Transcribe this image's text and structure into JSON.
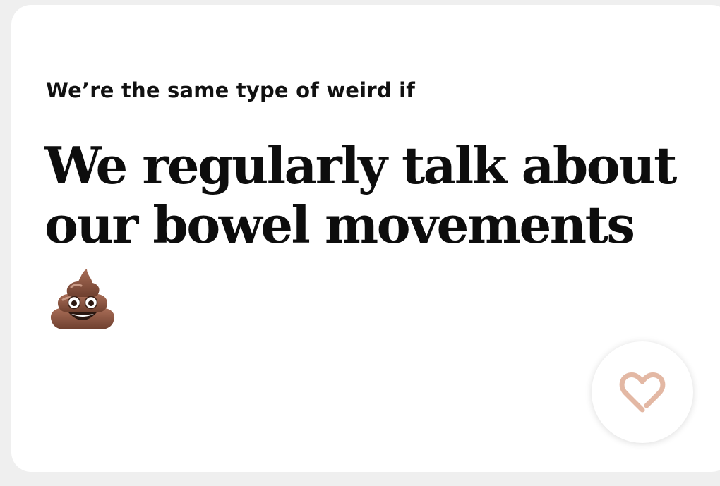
{
  "prompt_card": {
    "prompt_text": "We’re the same type of weird if",
    "answer_text": "We regularly talk about our bowel movements",
    "emoji": "pile-of-poo-emoji"
  },
  "like_button": {
    "icon": "heart-outline-icon",
    "accent_color": "#e3b8a4"
  }
}
